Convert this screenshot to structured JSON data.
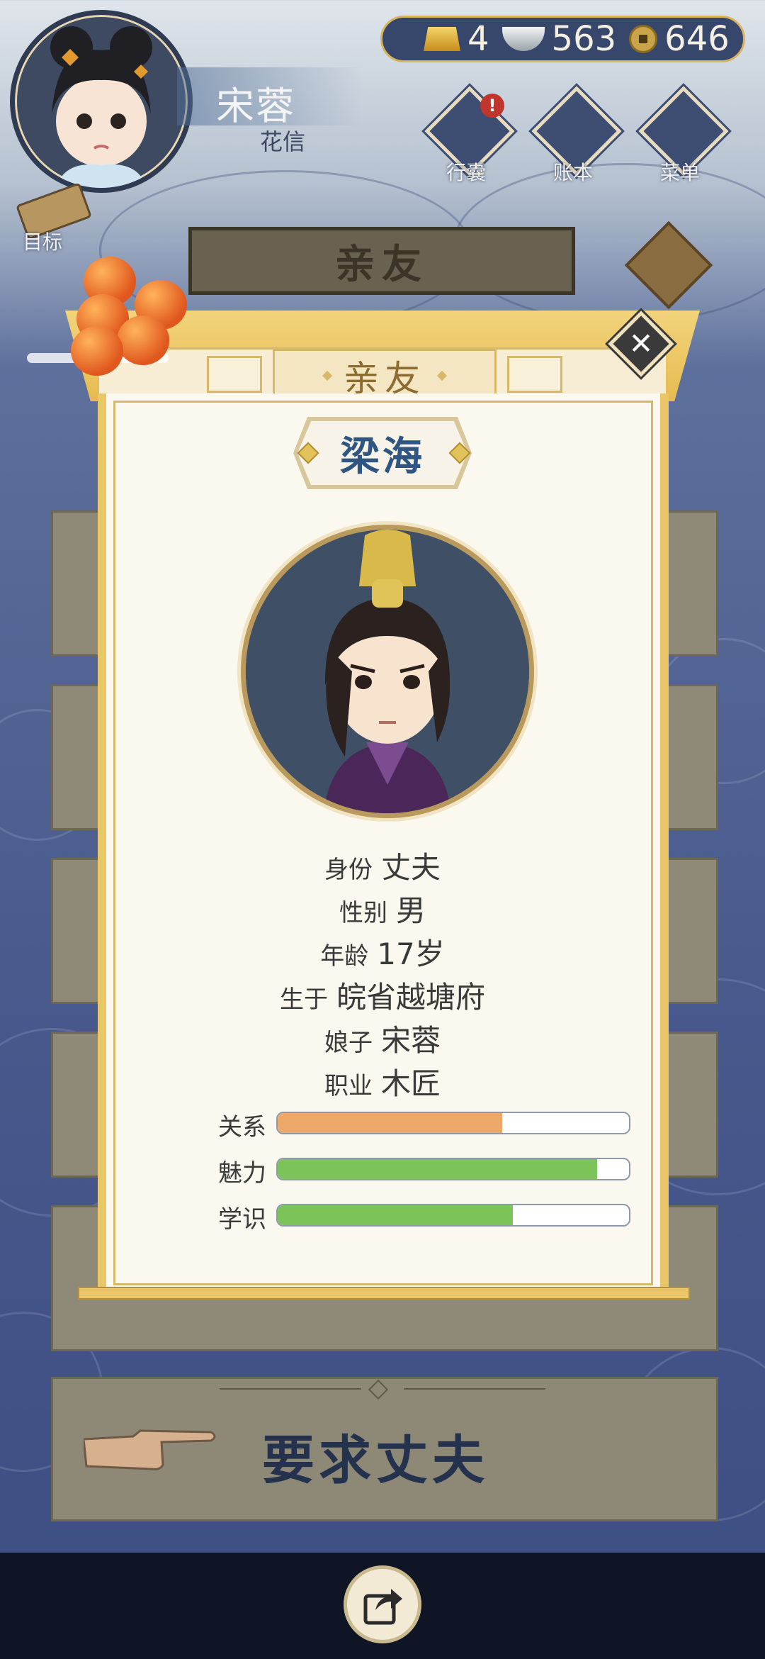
{
  "player": {
    "name": "宋蓉",
    "title": "花信"
  },
  "currency": {
    "gold": "4",
    "silver": "563",
    "copper": "646"
  },
  "menu": [
    {
      "label": "行囊",
      "icon": "bag-icon",
      "alert": "!"
    },
    {
      "label": "账本",
      "icon": "ledger-icon"
    },
    {
      "label": "菜单",
      "icon": "more-icon"
    }
  ],
  "goal_label": "目标",
  "background_title": "亲友",
  "modal": {
    "tab_title": "亲友",
    "character_name": "梁海",
    "info": [
      {
        "label": "身份",
        "value": "丈夫"
      },
      {
        "label": "性别",
        "value": "男"
      },
      {
        "label": "年龄",
        "value": "17岁"
      },
      {
        "label": "生于",
        "value": "皖省越塘府"
      },
      {
        "label": "娘子",
        "value": "宋蓉"
      },
      {
        "label": "职业",
        "value": "木匠"
      }
    ],
    "stats": [
      {
        "label": "关系",
        "value": 0.64,
        "color": "#eda86a"
      },
      {
        "label": "魅力",
        "value": 0.91,
        "color": "#7cc35a"
      },
      {
        "label": "学识",
        "value": 0.67,
        "color": "#7cc35a"
      }
    ]
  },
  "action_button": "要求丈夫"
}
